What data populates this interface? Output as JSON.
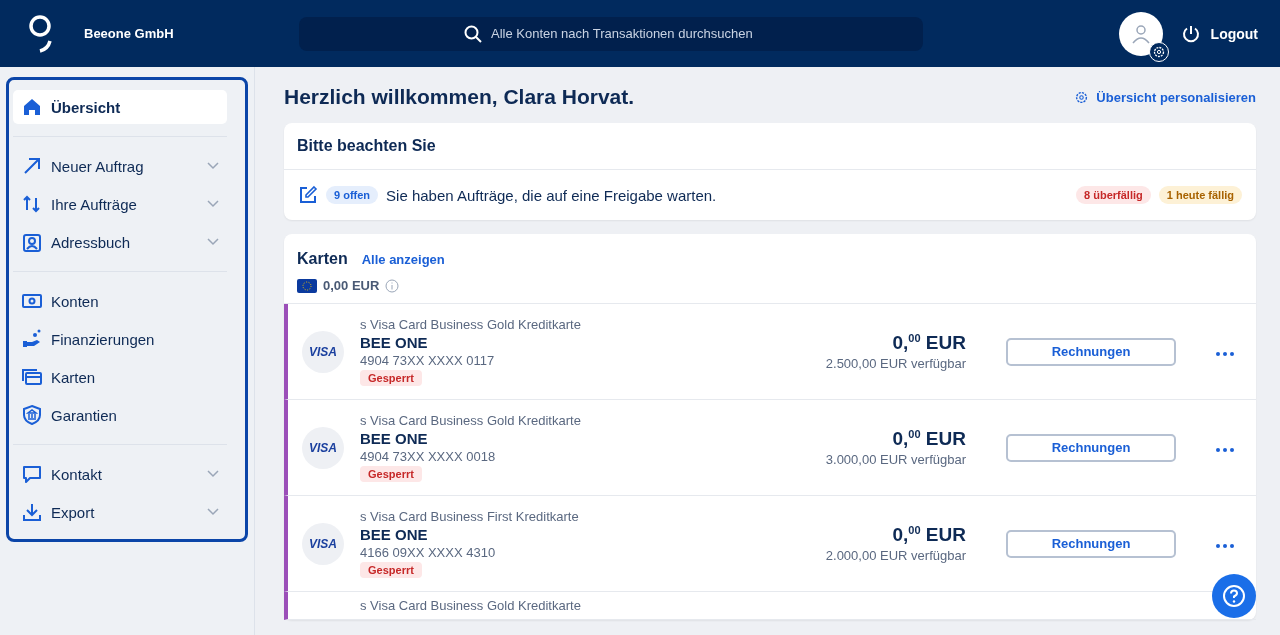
{
  "header": {
    "company": "Beeone GmbH",
    "search": {
      "placeholder": "Alle Konten nach Transaktionen durchsuchen"
    },
    "logout": "Logout"
  },
  "sidebar": {
    "groups": [
      [
        {
          "label": "Übersicht",
          "selected": true,
          "expandable": false
        }
      ],
      [
        {
          "label": "Neuer Auftrag",
          "selected": false,
          "expandable": true
        },
        {
          "label": "Ihre Aufträge",
          "selected": false,
          "expandable": true
        },
        {
          "label": "Adressbuch",
          "selected": false,
          "expandable": true
        }
      ],
      [
        {
          "label": "Konten",
          "selected": false,
          "expandable": false
        },
        {
          "label": "Finanzierungen",
          "selected": false,
          "expandable": false
        },
        {
          "label": "Karten",
          "selected": false,
          "expandable": false
        },
        {
          "label": "Garantien",
          "selected": false,
          "expandable": false
        }
      ],
      [
        {
          "label": "Kontakt",
          "selected": false,
          "expandable": true
        },
        {
          "label": "Export",
          "selected": false,
          "expandable": true
        }
      ]
    ]
  },
  "main": {
    "greeting": "Herzlich willkommen, Clara Horvat.",
    "personalize": "Übersicht personalisieren",
    "notice": {
      "title": "Bitte beachten Sie",
      "count": "9 offen",
      "message": "Sie haben Aufträge, die auf eine Freigabe warten.",
      "badges": [
        {
          "text": "8 überfällig",
          "kind": "danger"
        },
        {
          "text": "1 heute fällig",
          "kind": "warning"
        }
      ]
    },
    "cards": {
      "title": "Karten",
      "link": "Alle anzeigen",
      "total": "0,00 EUR",
      "rows": [
        {
          "product": "s Visa Card Business Gold Kreditkarte",
          "brand": "VISA",
          "name": "BEE ONE",
          "number": "4904 73XX XXXX 0117",
          "status": "Gesperrt",
          "amount": "0,$^{00}$ EUR",
          "available": "2.500,00 EUR verfügbar",
          "button": "Rechnungen"
        },
        {
          "product": "s Visa Card Business Gold Kreditkarte",
          "brand": "VISA",
          "name": "BEE ONE",
          "number": "4904 73XX XXXX 0018",
          "status": "Gesperrt",
          "amount": "0,$^{00}$ EUR",
          "available": "3.000,00 EUR verfügbar",
          "button": "Rechnungen"
        },
        {
          "product": "s Visa Card Business First Kreditkarte",
          "brand": "VISA",
          "name": "BEE ONE",
          "number": "4166 09XX XXXX 4310",
          "status": "Gesperrt",
          "amount": "0,$^{00}$ EUR",
          "available": "2.000,00 EUR verfügbar",
          "button": "Rechnungen"
        },
        {
          "product": "s Visa Card Business Gold Kreditkarte"
        }
      ]
    }
  }
}
